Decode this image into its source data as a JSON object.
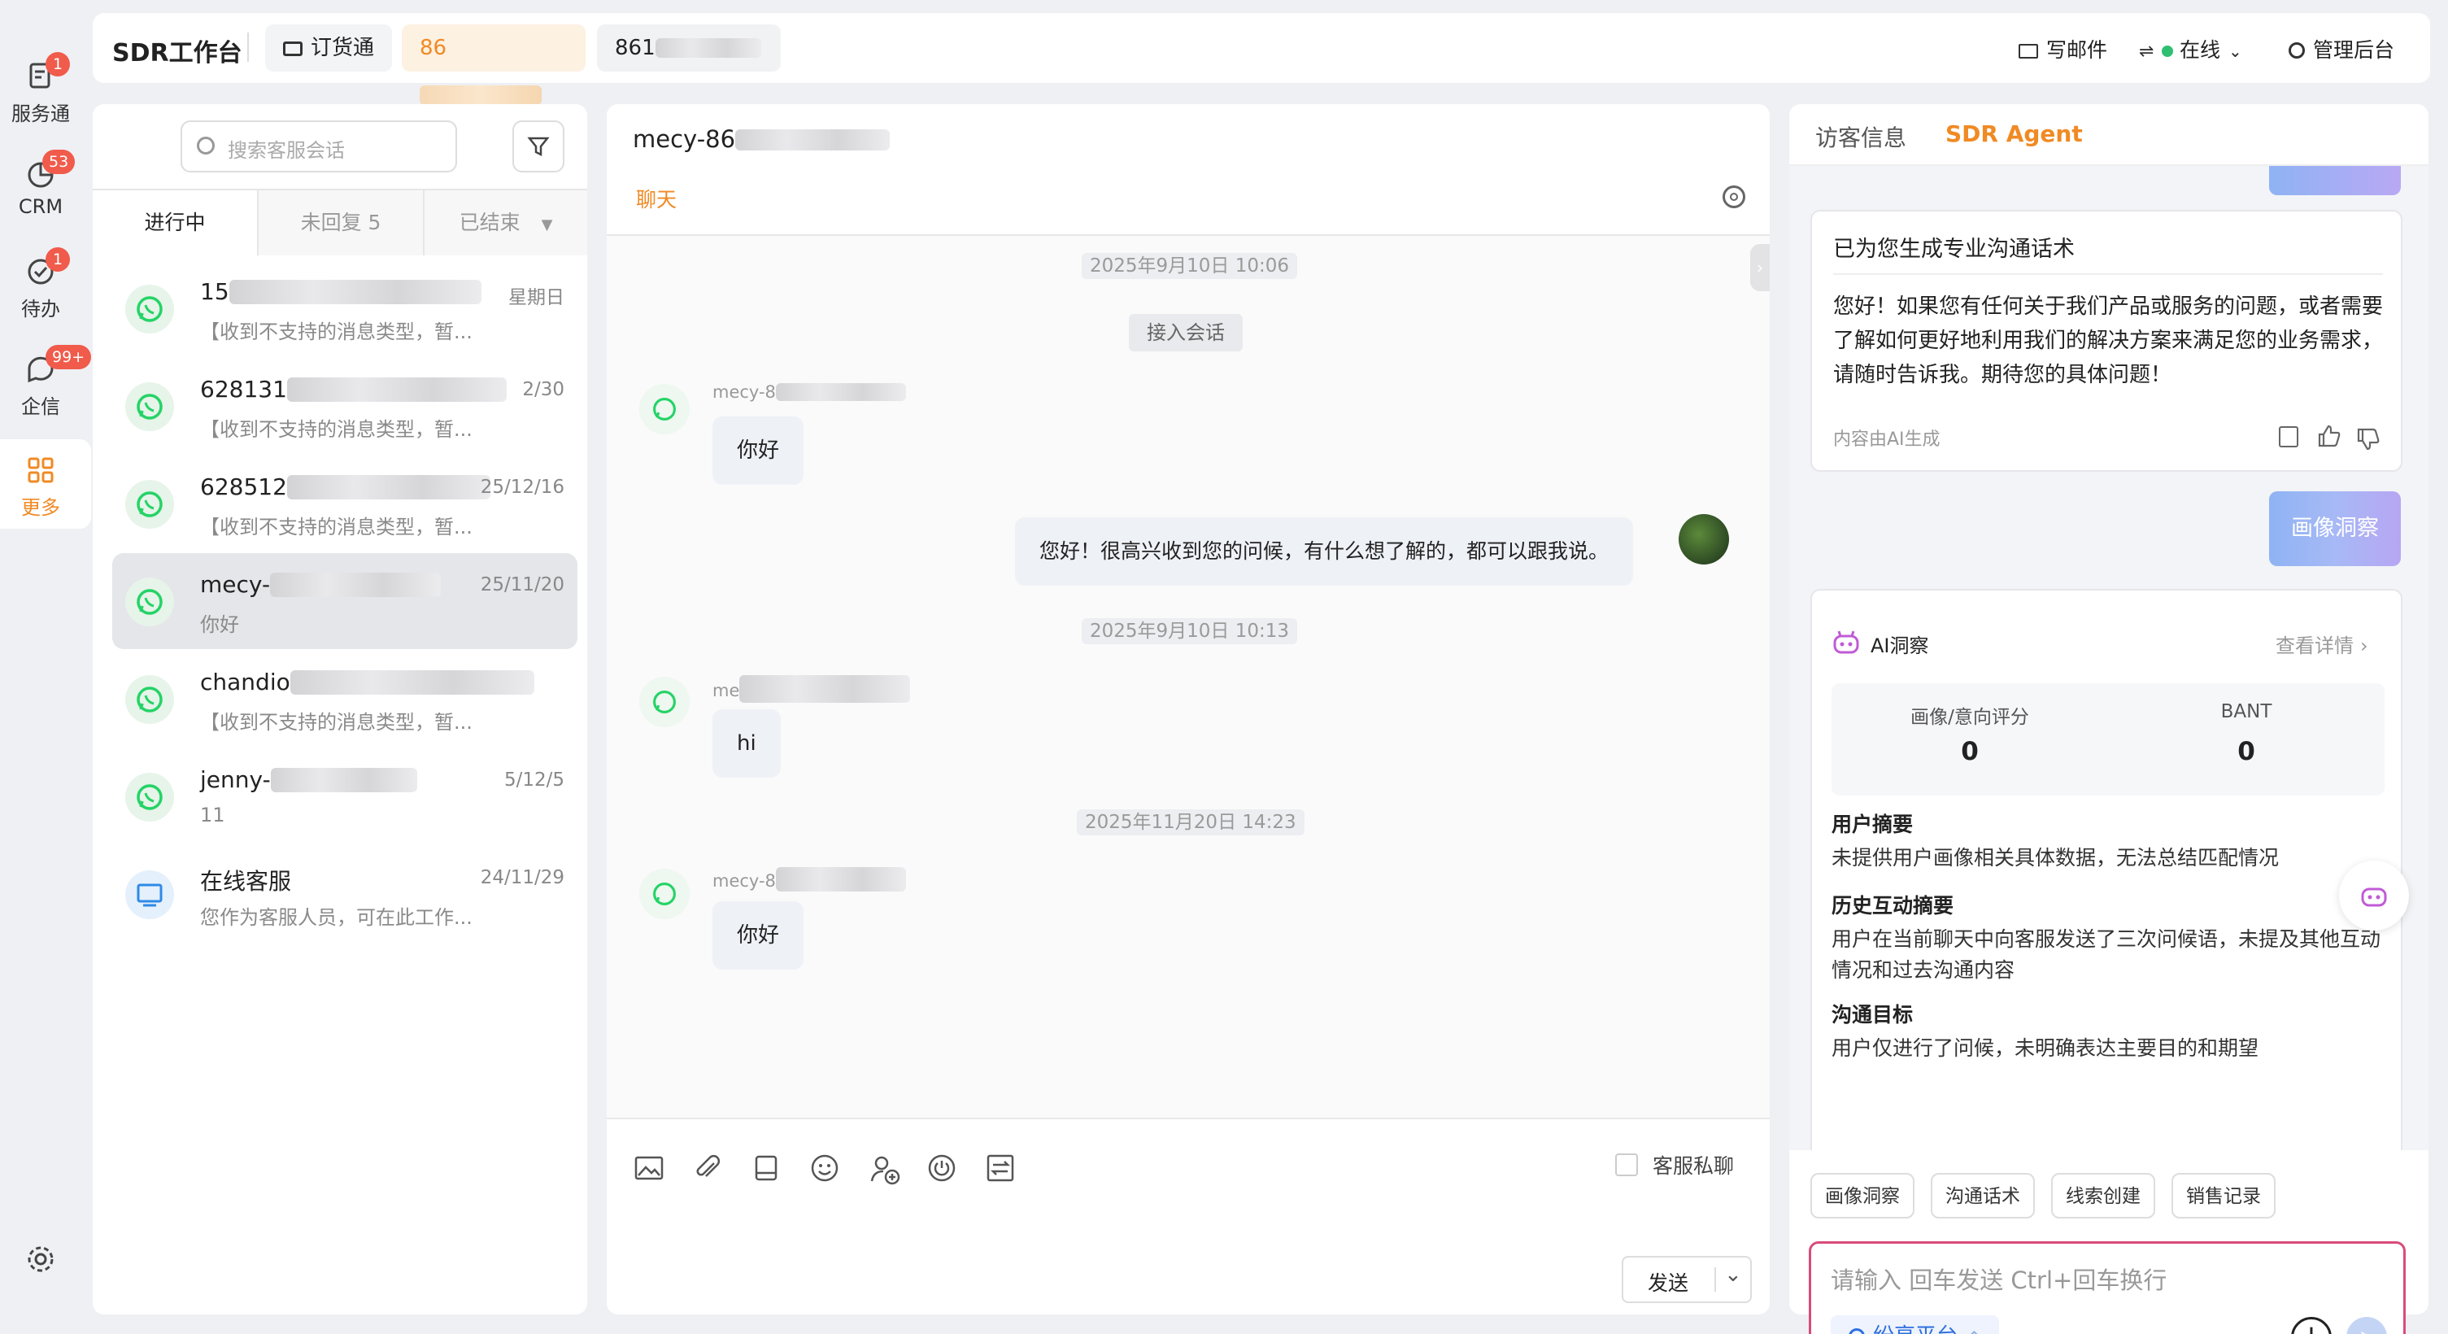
{
  "sidebar": {
    "items": [
      {
        "label": "服务通",
        "badge": "1"
      },
      {
        "label": "CRM",
        "badge": "53"
      },
      {
        "label": "待办",
        "badge": "1"
      },
      {
        "label": "企信",
        "badge": "99+"
      },
      {
        "label": "更多",
        "badge": ""
      }
    ]
  },
  "topbar": {
    "title": "SDR工作台",
    "order_btn": "订货通",
    "phone1": "86",
    "phone2": "861",
    "write_mail": "写邮件",
    "status": "在线",
    "admin": "管理后台"
  },
  "conversation_list": {
    "search_placeholder": "搜索客服会话",
    "tabs": [
      "进行中",
      "未回复 5",
      "已结束"
    ],
    "items": [
      {
        "name": "15",
        "time": "星期日",
        "preview": "【收到不支持的消息类型，暂..."
      },
      {
        "name": "628131",
        "time": "2/30",
        "preview": "【收到不支持的消息类型，暂..."
      },
      {
        "name": "628512",
        "time": "25/12/16",
        "preview": "【收到不支持的消息类型，暂..."
      },
      {
        "name": "mecy-",
        "time": "25/11/20",
        "preview": "你好"
      },
      {
        "name": "chandio",
        "time": "",
        "preview": "【收到不支持的消息类型，暂..."
      },
      {
        "name": "jenny-",
        "time": "5/12/5",
        "preview": "11"
      },
      {
        "name": "在线客服",
        "time": "24/11/29",
        "preview": "您作为客服人员，可在此工作..."
      }
    ]
  },
  "chat": {
    "title": "mecy-86",
    "tab": "聊天",
    "ts1": "2025年9月10日 10:06",
    "join": "接入会话",
    "sender1": "mecy-8",
    "msg1": "你好",
    "reply": "您好！很高兴收到您的问候，有什么想了解的，都可以跟我说。",
    "ts2": "2025年9月10日 10:13",
    "sender2": "me",
    "msg2": "hi",
    "ts3": "2025年11月20日 14:23",
    "sender3": "mecy-8",
    "msg3": "你好",
    "private_label": "客服私聊",
    "send": "发送"
  },
  "agent": {
    "tabs": [
      "访客信息",
      "SDR Agent"
    ],
    "card_title": "已为您生成专业沟通话术",
    "card_body": "您好！如果您有任何关于我们产品或服务的问题，或者需要了解如何更好地利用我们的解决方案来满足您的业务需求，请随时告诉我。期待您的具体问题！",
    "card_note": "内容由AI生成",
    "user_bubble": "画像洞察",
    "insight": {
      "title": "AI洞察",
      "detail": "查看详情",
      "score1_label": "画像/意向评分",
      "score1": "0",
      "score2_label": "BANT",
      "score2": "0",
      "sections": [
        {
          "h": "用户摘要",
          "t": "未提供用户画像相关具体数据，无法总结匹配情况"
        },
        {
          "h": "历史互动摘要",
          "t": "用户在当前聊天中向客服发送了三次问候语，未提及其他互动情况和过去沟通内容"
        },
        {
          "h": "沟通目标",
          "t": "用户仅进行了问候，未明确表达主要目的和期望"
        }
      ]
    },
    "chips": [
      "画像洞察",
      "沟通话术",
      "线索创建",
      "销售记录"
    ],
    "input_placeholder": "请输入 回车发送 Ctrl+回车换行",
    "platform": "纷享平台"
  },
  "colors": {
    "accent": "#f08a24",
    "whatsapp": "#25d366",
    "online": "#2fbf71",
    "badge": "#f05b4b"
  }
}
